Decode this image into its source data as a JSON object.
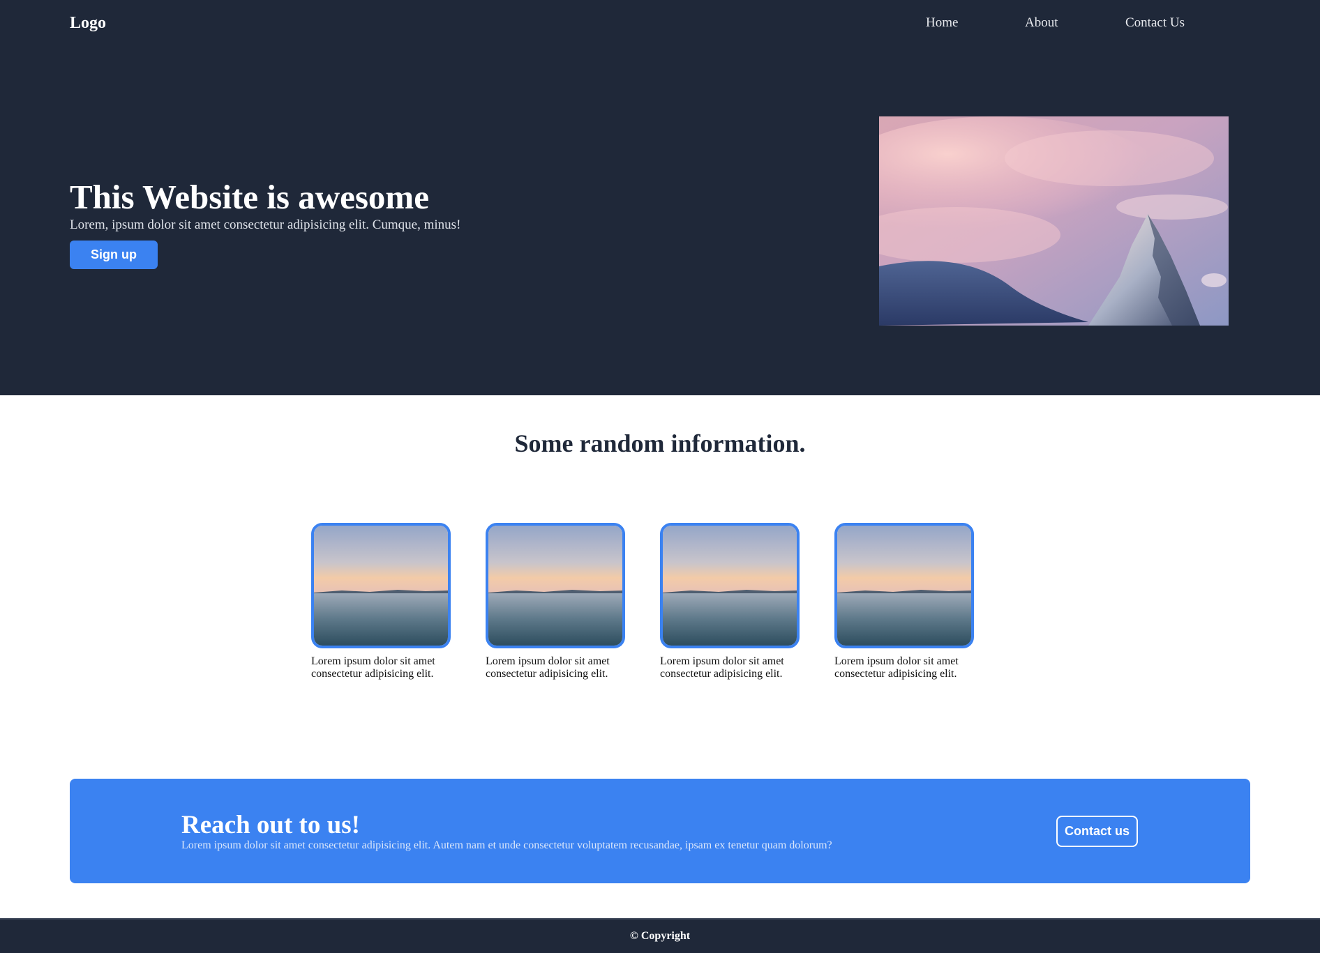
{
  "navbar": {
    "logo": "Logo",
    "links": [
      "Home",
      "About",
      "Contact Us"
    ]
  },
  "hero": {
    "title": "This Website is awesome",
    "subtitle": "Lorem, ipsum dolor sit amet consectetur adipisicing elit. Cumque, minus!",
    "signup_label": "Sign up",
    "image_icon": "mountain-peak-photo"
  },
  "info": {
    "title": "Some random information.",
    "cards": [
      {
        "text": "Lorem ipsum dolor sit amet consectetur adipisicing elit.",
        "image_icon": "sea-sunset-photo"
      },
      {
        "text": "Lorem ipsum dolor sit amet consectetur adipisicing elit.",
        "image_icon": "sea-sunset-photo"
      },
      {
        "text": "Lorem ipsum dolor sit amet consectetur adipisicing elit.",
        "image_icon": "sea-sunset-photo"
      },
      {
        "text": "Lorem ipsum dolor sit amet consectetur adipisicing elit.",
        "image_icon": "sea-sunset-photo"
      }
    ]
  },
  "cta": {
    "title": "Reach out to us!",
    "subtitle": "Lorem ipsum dolor sit amet consectetur adipisicing elit. Autem nam et unde consectetur voluptatem recusandae, ipsam ex tenetur quam dolorum?",
    "button_label": "Contact us"
  },
  "footer": {
    "copyright": "© Copyright"
  },
  "colors": {
    "dark_navy": "#1f2839",
    "accent_blue": "#3b82f1",
    "white": "#ffffff"
  }
}
